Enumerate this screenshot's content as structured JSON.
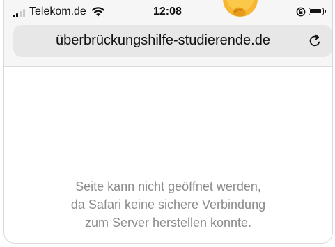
{
  "status_bar": {
    "carrier": "Telekom.de",
    "time": "12:08",
    "icons": [
      "cellular-signal-icon",
      "wifi-icon",
      "thinking-face-emoji",
      "rotation-lock-icon",
      "battery-icon"
    ]
  },
  "address_bar": {
    "url": "überbrückungshilfe-studierende.de",
    "reload_icon": "reload-icon"
  },
  "error": {
    "lines": [
      "Seite kann nicht geöffnet werden,",
      "da Safari keine sichere Verbindung",
      "zum Server herstellen konnte."
    ]
  },
  "colors": {
    "chrome_background": "#f6f6f6",
    "address_field": "#e7e7e7",
    "error_text": "#8c8c8c"
  }
}
